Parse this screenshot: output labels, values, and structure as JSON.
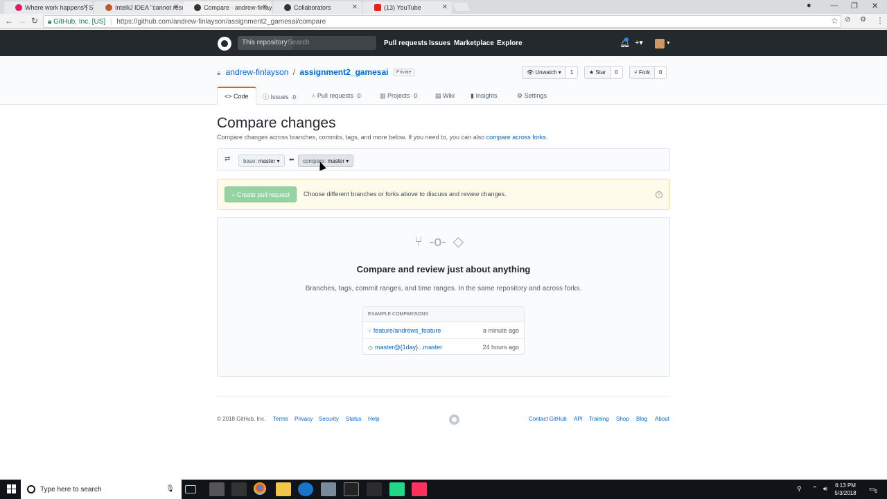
{
  "browser": {
    "tabs": [
      {
        "title": "Where work happens | Sl",
        "active": false
      },
      {
        "title": "IntelliJ IDEA \"cannot reso",
        "active": false
      },
      {
        "title": "Compare · andrew-finlay",
        "active": true
      },
      {
        "title": "Collaborators",
        "active": false
      },
      {
        "title": "(13) YouTube",
        "active": false
      }
    ],
    "security_label": "GitHub, Inc. [US]",
    "url": "https://github.com/andrew-finlayson/assignment2_gamesai/compare"
  },
  "header": {
    "scope_label": "This repository",
    "search_placeholder": "Search",
    "nav": [
      "Pull requests",
      "Issues",
      "Marketplace",
      "Explore"
    ],
    "plus_label": "+▾"
  },
  "repo": {
    "owner": "andrew-finlayson",
    "name": "assignment2_gamesai",
    "visibility": "Private",
    "watch": {
      "label": "Unwatch ▾",
      "count": "1"
    },
    "star": {
      "label": "Star",
      "count": "0"
    },
    "fork": {
      "label": "Fork",
      "count": "0"
    },
    "tabs": [
      {
        "label": "Code",
        "count": ""
      },
      {
        "label": "Issues",
        "count": "0"
      },
      {
        "label": "Pull requests",
        "count": "0"
      },
      {
        "label": "Projects",
        "count": "0"
      },
      {
        "label": "Wiki",
        "count": ""
      },
      {
        "label": "Insights",
        "count": ""
      },
      {
        "label": "Settings",
        "count": ""
      }
    ]
  },
  "compare": {
    "title": "Compare changes",
    "subtitle": "Compare changes across branches, commits, tags, and more below. If you need to, you can also ",
    "subtitle_link": "compare across forks.",
    "base_key": "base:",
    "base_value": "master",
    "compare_key": "compare:",
    "compare_value": "master",
    "create_pr_label": "Create pull request",
    "flash_message": "Choose different branches or forks above to discuss and review changes.",
    "blank_title": "Compare and review just about anything",
    "blank_desc": "Branches, tags, commit ranges, and time ranges. In the same repository and across forks.",
    "examples_header": "EXAMPLE COMPARISONS",
    "examples": [
      {
        "ref": "feature/andrews_feature",
        "time": "a minute ago"
      },
      {
        "ref": "master@{1day}...master",
        "time": "24 hours ago"
      }
    ]
  },
  "footer": {
    "copyright": "© 2018 GitHub, Inc.",
    "left_links": [
      "Terms",
      "Privacy",
      "Security",
      "Status",
      "Help"
    ],
    "right_links": [
      "Contact GitHub",
      "API",
      "Training",
      "Shop",
      "Blog",
      "About"
    ]
  },
  "taskbar": {
    "search_placeholder": "Type here to search",
    "time": "6:13 PM",
    "date": "5/3/2018",
    "notification_count": "6"
  },
  "colors": {
    "header_bg": "#24292e",
    "link": "#0366d6",
    "create_pr_disabled": "#94d3a2",
    "flash_bg": "#fffbea"
  }
}
